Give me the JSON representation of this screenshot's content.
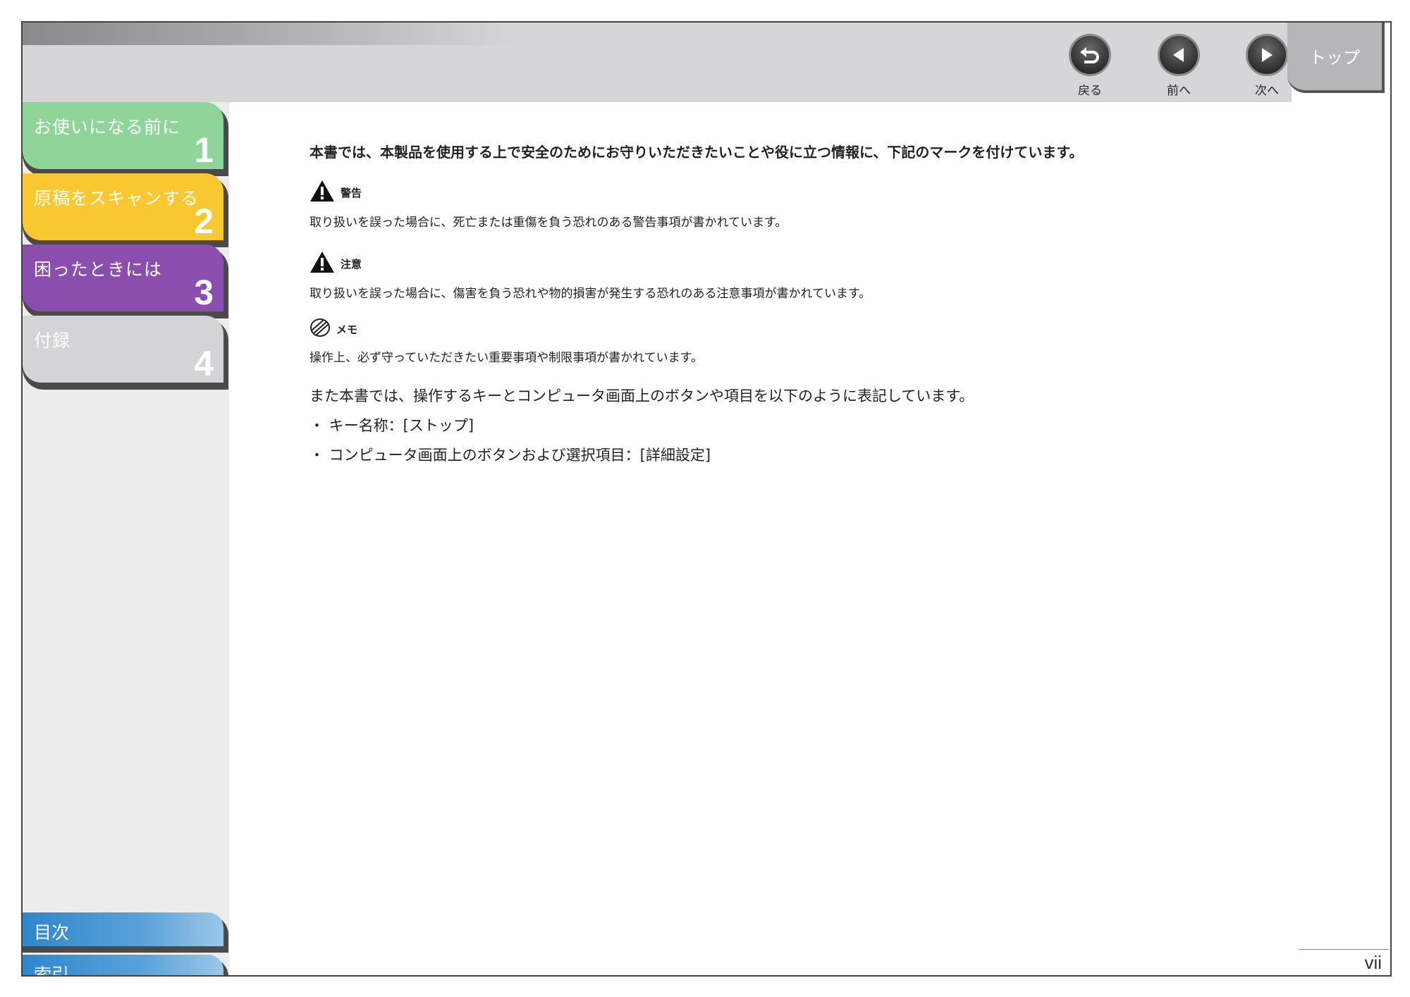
{
  "nav": {
    "back_label": "戻る",
    "prev_label": "前へ",
    "next_label": "次へ",
    "top_label": "トップ"
  },
  "sidebar": {
    "tabs": [
      {
        "label": "お使いになる前に",
        "num": "1",
        "color": "#8fd499"
      },
      {
        "label": "原稿をスキャンする",
        "num": "2",
        "color": "#fcc831"
      },
      {
        "label": "困ったときには",
        "num": "3",
        "color": "#8b4eaf"
      },
      {
        "label": "付録",
        "num": "4",
        "color": "#d4d4d6"
      }
    ],
    "links": [
      {
        "label": "目次"
      },
      {
        "label": "索引"
      }
    ]
  },
  "content": {
    "intro": "本書では、本製品を使用する上で安全のためにお守りいただきたいことや役に立つ情報に、下記のマークを付けています。",
    "marks": [
      {
        "icon": "warning-icon",
        "title": "警告",
        "desc": "取り扱いを誤った場合に、死亡または重傷を負う恐れのある警告事項が書かれています。"
      },
      {
        "icon": "caution-icon",
        "title": "注意",
        "desc": "取り扱いを誤った場合に、傷害を負う恐れや物的損害が発生する恐れのある注意事項が書かれています。"
      },
      {
        "icon": "memo-icon",
        "title": "メモ",
        "desc": "操作上、必ず守っていただきたい重要事項や制限事項が書かれています。"
      }
    ],
    "notation": "また本書では、操作するキーとコンピュータ画面上のボタンや項目を以下のように表記しています。",
    "bullets": [
      "・ キー名称：[ストップ]",
      "・ コンピュータ画面上のボタンおよび選択項目：[詳細設定]"
    ]
  },
  "page_number": "vii"
}
